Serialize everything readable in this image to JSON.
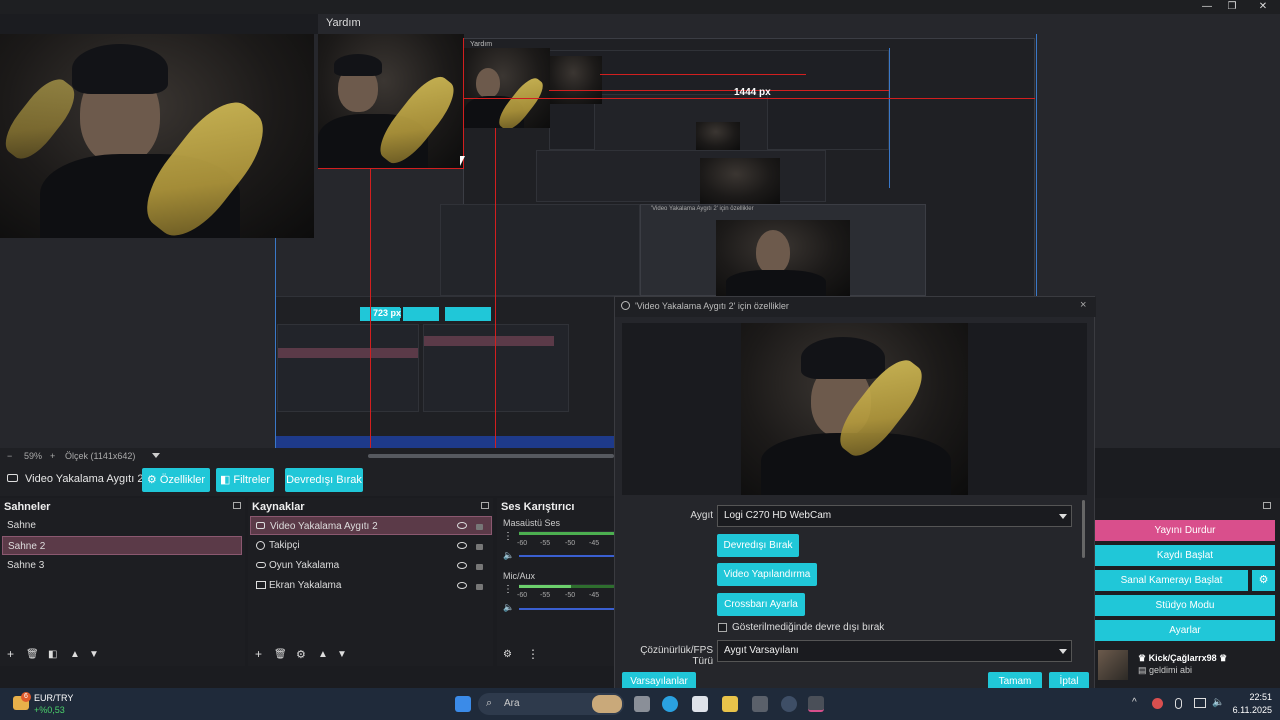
{
  "window": {
    "menu_item": "Yardım",
    "controls": [
      "—",
      "❐",
      "✕"
    ]
  },
  "preview": {
    "measure_label_1": "1444 px",
    "measure_label_2": "723 px",
    "nested_menu": "Yardım",
    "nested_dialog_title": "'Video Yakalama Aygıtı 2' için özellikler"
  },
  "zoom": {
    "minus": "−",
    "plus": "+",
    "level": "59%",
    "scale_text": "Ölçek (1141x642)"
  },
  "source_toolbar": {
    "current_source": "Video Yakalama Aygıtı 2",
    "properties_label": "Özellikler",
    "filters_label": "Filtreler",
    "deactivate_label": "Devredışı Bırak"
  },
  "scenes": {
    "title": "Sahneler",
    "items": [
      "Sahne",
      "Sahne 2",
      "Sahne 3"
    ],
    "selected_index": 1
  },
  "sources": {
    "title": "Kaynaklar",
    "items": [
      {
        "label": "Video Yakalama Aygıtı 2",
        "icon": "camera-icon"
      },
      {
        "label": "Takipçi",
        "icon": "browser-icon"
      },
      {
        "label": "Oyun Yakalama",
        "icon": "gamepad-icon"
      },
      {
        "label": "Ekran Yakalama",
        "icon": "monitor-icon"
      }
    ],
    "selected_index": 0
  },
  "mixer": {
    "title": "Ses Karıştırıcı",
    "channels": [
      {
        "name": "Masaüstü Ses",
        "ticks": [
          "-60",
          "-55",
          "-50",
          "-45"
        ]
      },
      {
        "name": "Mic/Aux",
        "ticks": [
          "-60",
          "-55",
          "-50",
          "-45"
        ]
      }
    ]
  },
  "controls": {
    "buttons": [
      "Yayını Durdur",
      "Kaydı Başlat",
      "Sanal Kamerayı Başlat",
      "Stüdyo Modu",
      "Ayarlar"
    ],
    "colors": {
      "stop": "#d94f8c",
      "normal": "#20c7d8"
    }
  },
  "chat": {
    "user": "Kick/Çağlarrx98",
    "message": "geldimi abi"
  },
  "dialog": {
    "title": "'Video Yakalama Aygıtı 2' için özellikler",
    "device_label": "Aygıt",
    "device_value": "Logi C270 HD WebCam",
    "btn_deactivate": "Devredışı Bırak",
    "btn_video_config": "Video Yapılandırma",
    "btn_crossbar": "Crossbarı Ayarla",
    "checkbox_label": "Gösterilmediğinde devre dışı bırak",
    "res_label": "Çözünürlük/FPS Türü",
    "res_value": "Aygıt Varsayılanı",
    "defaults_btn": "Varsayılanlar",
    "ok_btn": "Tamam",
    "cancel_btn": "İptal"
  },
  "taskbar": {
    "currency": "EUR/TRY",
    "currency_change": "+%0,53",
    "currency_badge": "6",
    "search_placeholder": "Ara",
    "time": "22:51",
    "date": "6.11.2025"
  },
  "accent": "#20c7d8"
}
